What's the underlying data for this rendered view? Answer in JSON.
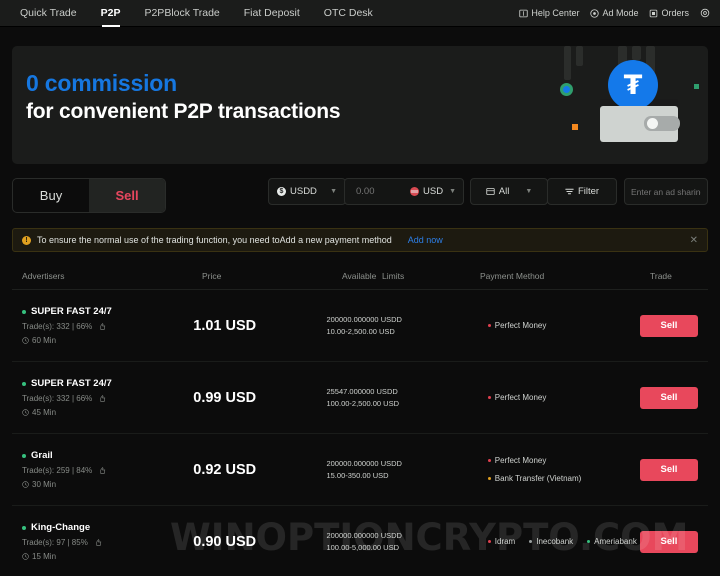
{
  "nav": {
    "items": [
      {
        "label": "Quick Trade",
        "active": false
      },
      {
        "label": "P2P",
        "active": true
      },
      {
        "label": "P2PBlock Trade",
        "active": false
      },
      {
        "label": "Fiat Deposit",
        "active": false
      },
      {
        "label": "OTC Desk",
        "active": false
      }
    ],
    "right": [
      {
        "label": "Help Center",
        "icon": "help-book-icon"
      },
      {
        "label": "Ad Mode",
        "icon": "ad-mode-icon"
      },
      {
        "label": "Orders",
        "icon": "orders-icon"
      }
    ],
    "settings_icon": "gear-icon"
  },
  "banner": {
    "line1": "0 commission",
    "line2": "for convenient P2P transactions",
    "accent_color": "#1677e0",
    "coin_symbol": "₮",
    "art": "usdd-coin-wallet-illustration"
  },
  "toolbar": {
    "buy_label": "Buy",
    "sell_label": "Sell",
    "sell_color": "#e8475f",
    "asset": "USDD",
    "amount_placeholder": "0.00",
    "amount_value": "",
    "fiat": "USD",
    "payment_filter": "All",
    "filter_label": "Filter",
    "ad_code_placeholder": "Enter an ad sharing cod"
  },
  "alert": {
    "text": "To ensure the normal use of the trading function, you need toAdd a new payment method",
    "link": "Add now",
    "link_color": "#2d7fe8",
    "close_icon": "close-icon"
  },
  "table": {
    "headers": [
      "Advertisers",
      "Price",
      "Available",
      "Limits",
      "Payment Method",
      "Trade"
    ],
    "trade_button_label": "Sell",
    "rows": [
      {
        "advertiser": "SUPER FAST 24/7",
        "trades": "Trade(s): 332 | 66%",
        "time": "60 Min",
        "price": "1.01 USD",
        "available": "200000.000000 USDD",
        "limits": "10.00-2,500.00 USD",
        "payments": [
          {
            "name": "Perfect Money",
            "color": "#e0404f"
          }
        ]
      },
      {
        "advertiser": "SUPER FAST 24/7",
        "trades": "Trade(s): 332 | 66%",
        "time": "45 Min",
        "price": "0.99 USD",
        "available": "25547.000000 USDD",
        "limits": "100.00-2,500.00 USD",
        "payments": [
          {
            "name": "Perfect Money",
            "color": "#e0404f"
          }
        ]
      },
      {
        "advertiser": "Grail",
        "trades": "Trade(s): 259 | 84%",
        "time": "30 Min",
        "price": "0.92 USD",
        "available": "200000.000000 USDD",
        "limits": "15.00-350.00 USD",
        "payments": [
          {
            "name": "Perfect Money",
            "color": "#e0404f"
          },
          {
            "name": "Bank Transfer (Vietnam)",
            "color": "#e0a020"
          }
        ]
      },
      {
        "advertiser": "King-Change",
        "trades": "Trade(s): 97 | 85%",
        "time": "15 Min",
        "price": "0.90 USD",
        "available": "200000.000000 USDD",
        "limits": "100.00-5,000.00 USD",
        "payments": [
          {
            "name": "Idram",
            "color": "#e0404f"
          },
          {
            "name": "Inecobank",
            "color": "#9aa0a0"
          },
          {
            "name": "Ameriabank",
            "color": "#36c07e"
          }
        ]
      }
    ]
  },
  "watermark": "WINOPTIONCRYPTO.COM"
}
